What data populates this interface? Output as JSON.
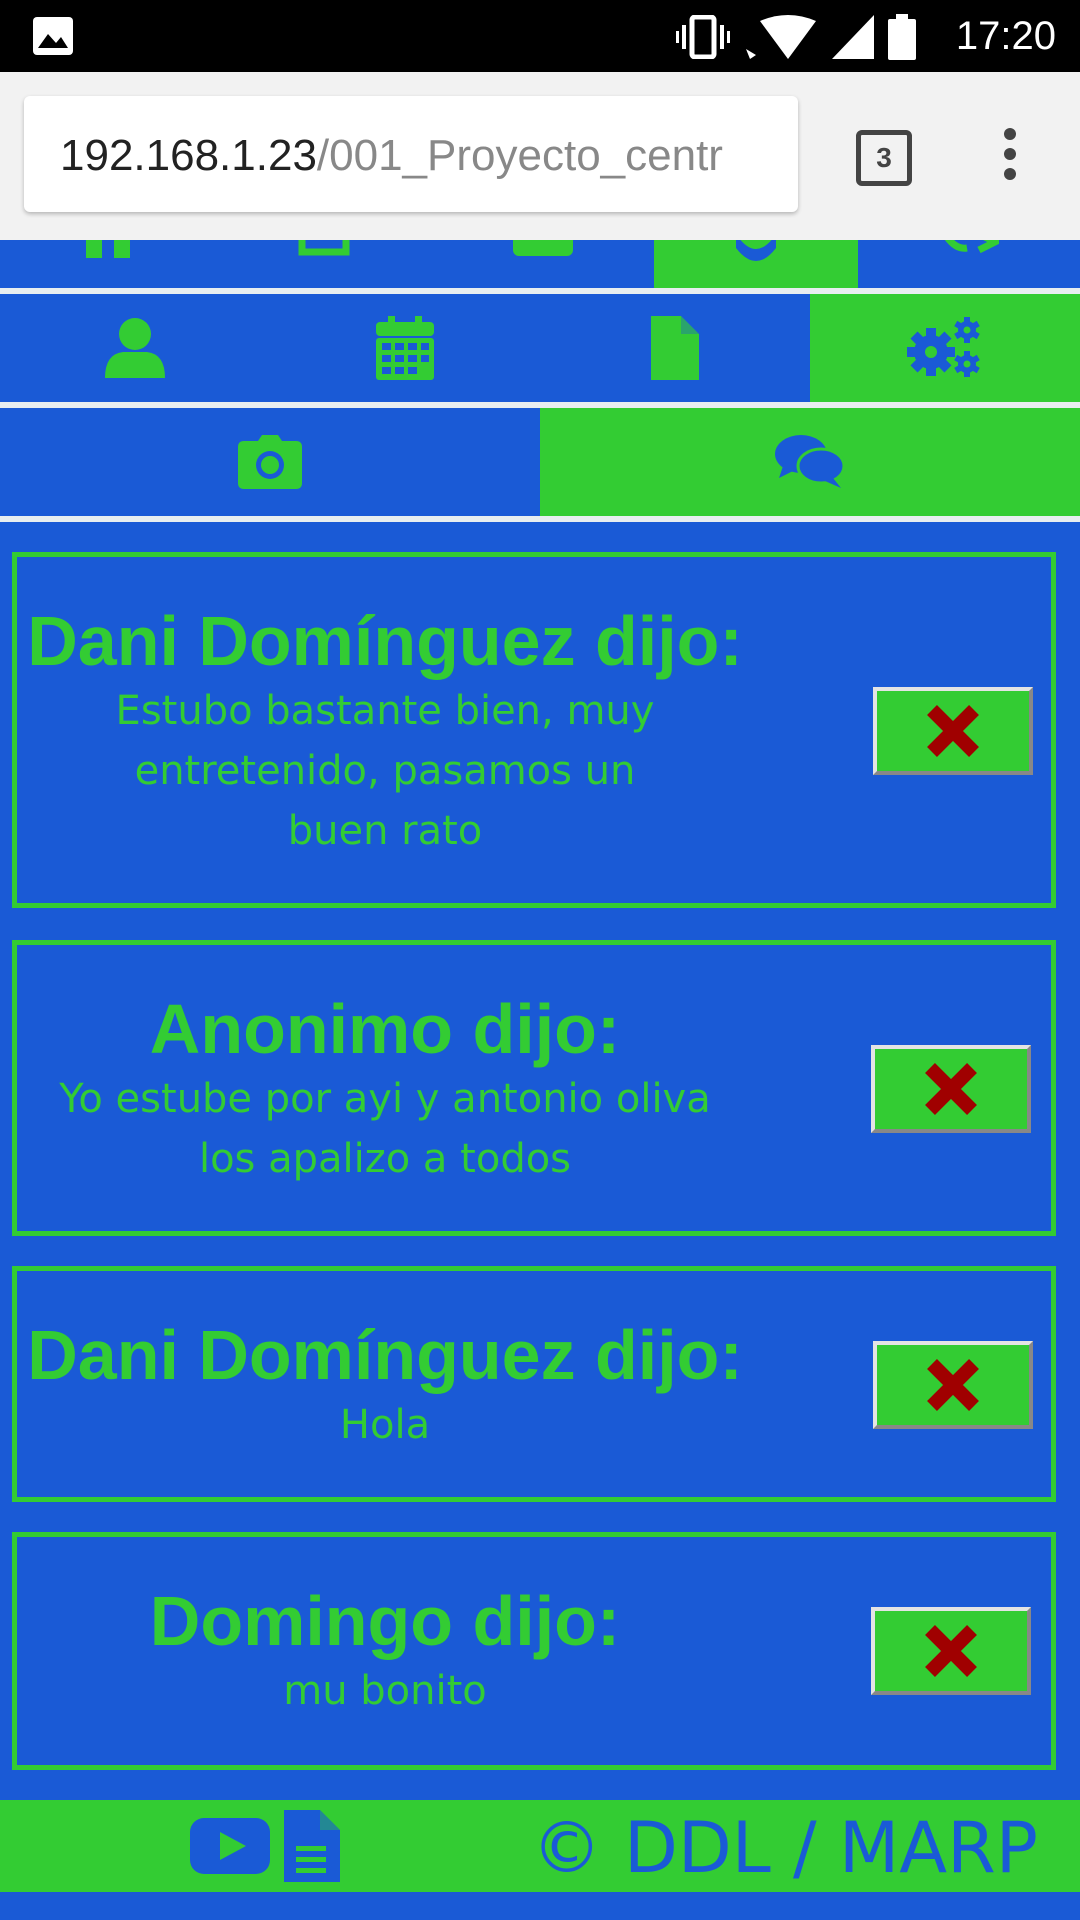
{
  "status_bar": {
    "time": "17:20"
  },
  "browser": {
    "url_host": "192.168.1.23",
    "url_path": "/001_Proyecto_centr",
    "tab_count": "3"
  },
  "colors": {
    "blue": "#1a5ad6",
    "green": "#33cc33",
    "delete_x": "#a00000"
  },
  "nav_top_partial": [
    "home-icon",
    "print-icon",
    "inbox-icon",
    "gear-icon",
    "sign-out-icon"
  ],
  "nav_main": {
    "items": [
      "user-icon",
      "calendar-icon",
      "file-icon",
      "gears-icon"
    ],
    "active": "gears-icon"
  },
  "nav_sub": {
    "items": [
      "camera-icon",
      "comments-icon"
    ],
    "active": "comments-icon"
  },
  "comments": [
    {
      "author": "Dani Domínguez dijo:",
      "message": "Estubo bastante bien, muy entretenido, pasamos un buen rato"
    },
    {
      "author": "Anonimo dijo:",
      "message": "Yo estube por ayi y antonio oliva los apalizo a todos"
    },
    {
      "author": "Dani Domínguez dijo:",
      "message": "Hola"
    },
    {
      "author": "Domingo dijo:",
      "message": "mu bonito"
    }
  ],
  "footer": {
    "icons": [
      "youtube-icon",
      "document-icon"
    ],
    "copyright": "© DDL / MARP"
  }
}
